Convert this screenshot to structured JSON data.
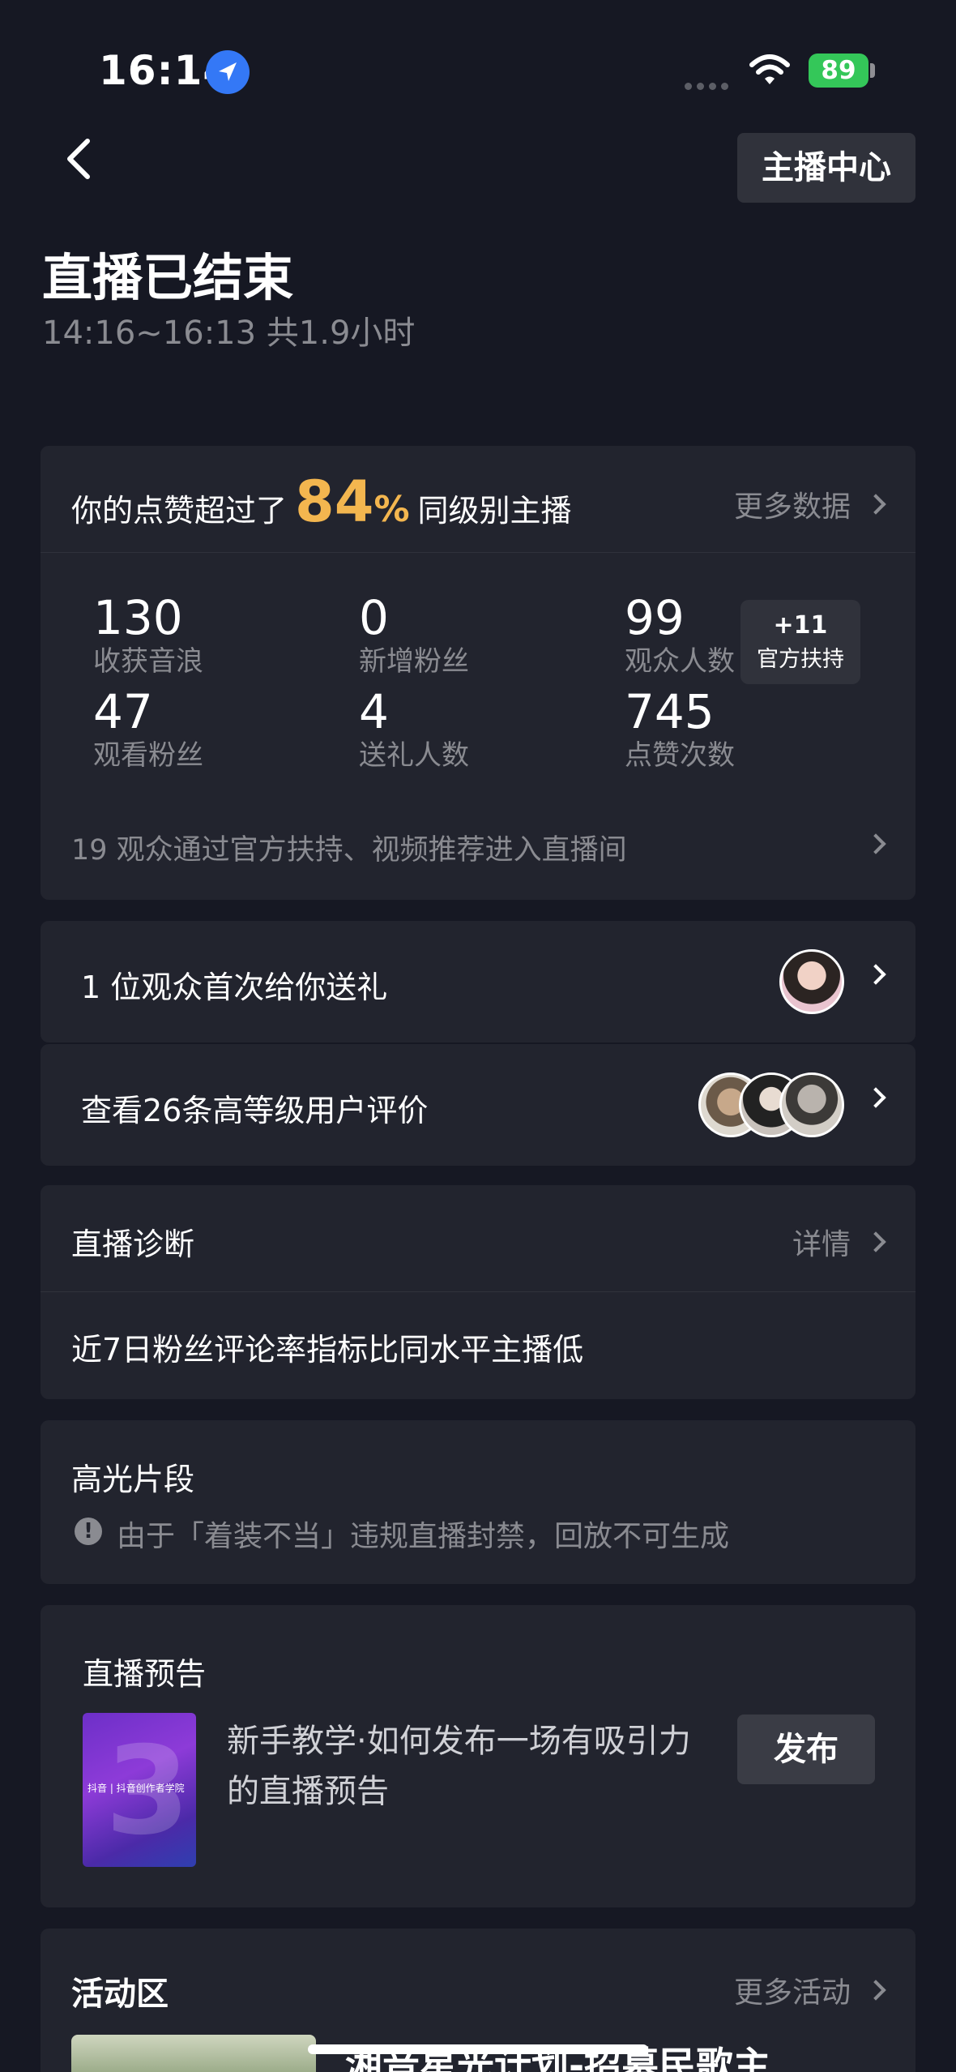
{
  "status_bar": {
    "time": "16:14",
    "battery": "89"
  },
  "header": {
    "center_button": "主播中心"
  },
  "summary": {
    "title": "直播已结束",
    "subtitle": "14:16~16:13 共1.9小时"
  },
  "likes_card": {
    "prefix": "你的点赞超过了",
    "percent": "84",
    "percent_unit": "%",
    "suffix": "同级别主播",
    "more_link": "更多数据",
    "stats": [
      {
        "value": "130",
        "label": "收获音浪"
      },
      {
        "value": "0",
        "label": "新增粉丝"
      },
      {
        "value": "99",
        "label": "观众人数"
      },
      {
        "value": "47",
        "label": "观看粉丝"
      },
      {
        "value": "4",
        "label": "送礼人数"
      },
      {
        "value": "745",
        "label": "点赞次数"
      }
    ],
    "badge": {
      "value": "+11",
      "label": "官方扶持"
    },
    "note": "19 观众通过官方扶持、视频推荐进入直播间"
  },
  "gift_row": {
    "text": "1 位观众首次给你送礼"
  },
  "review_row": {
    "text": "查看26条高等级用户评价"
  },
  "diagnosis": {
    "title": "直播诊断",
    "link": "详情",
    "text": "近7日粉丝评论率指标比同水平主播低"
  },
  "highlights": {
    "title": "高光片段",
    "warning": "由于「着装不当」违规直播封禁，回放不可生成"
  },
  "preview": {
    "title": "直播预告",
    "thumb_caption": "抖音 | 抖音创作者学院",
    "text": "新手教学·如何发布一场有吸引力的直播预告",
    "button": "发布"
  },
  "activity": {
    "title": "活动区",
    "link": "更多活动",
    "first_item": "湘音星光计划-招募民歌主"
  }
}
